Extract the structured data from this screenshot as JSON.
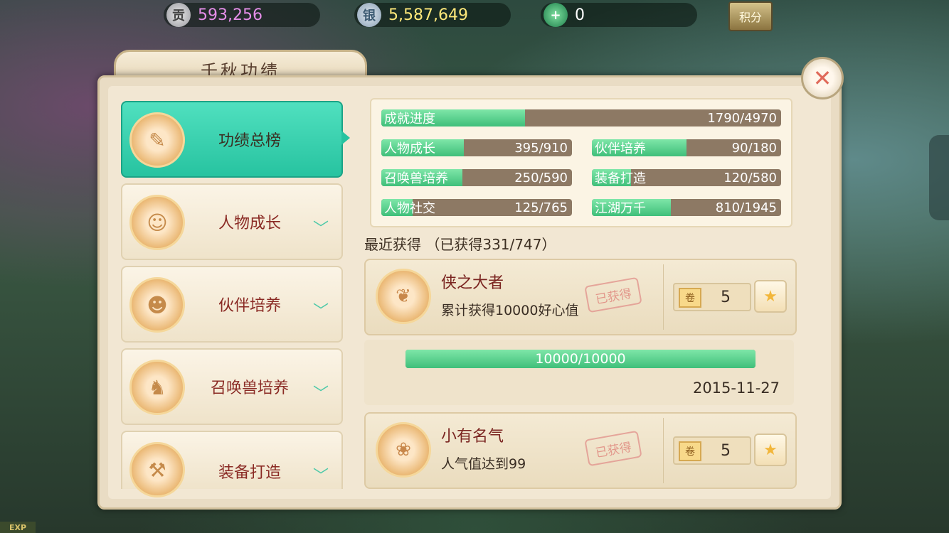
{
  "resources": {
    "gong": {
      "icon": "contribution-coin-icon",
      "glyph": "贡",
      "value": "593,256"
    },
    "silver": {
      "icon": "silver-ingot-icon",
      "glyph": "银",
      "value": "5,587,649"
    },
    "jade": {
      "icon": "jade-coin-icon",
      "glyph": "+",
      "value": "0"
    },
    "points_label": "积分"
  },
  "panel": {
    "title": "千秋功绩",
    "close_glyph": "✕"
  },
  "nav": [
    {
      "label": "功绩总榜",
      "active": true,
      "glyph": "✎"
    },
    {
      "label": "人物成长",
      "chevron": "﹀",
      "glyph": "☺"
    },
    {
      "label": "伙伴培养",
      "chevron": "﹀",
      "glyph": "☻"
    },
    {
      "label": "召唤兽培养",
      "chevron": "﹀",
      "glyph": "♞"
    },
    {
      "label": "装备打造",
      "chevron": "﹀",
      "glyph": "⚒"
    }
  ],
  "progress": {
    "overall": {
      "label": "成就进度",
      "text": "1790/4970",
      "value": 1790,
      "max": 4970
    },
    "categories": [
      {
        "label": "人物成长",
        "text": "395/910",
        "value": 395,
        "max": 910
      },
      {
        "label": "伙伴培养",
        "text": "90/180",
        "value": 90,
        "max": 180
      },
      {
        "label": "召唤兽培养",
        "text": "250/590",
        "value": 250,
        "max": 590
      },
      {
        "label": "装备打造",
        "text": "120/580",
        "value": 120,
        "max": 580
      },
      {
        "label": "人物社交",
        "text": "125/765",
        "value": 125,
        "max": 765
      },
      {
        "label": "江湖万千",
        "text": "810/1945",
        "value": 810,
        "max": 1945
      }
    ]
  },
  "recent": {
    "title": "最近获得  （已获得331/747）",
    "items": [
      {
        "name": "侠之大者",
        "desc": "累计获得10000好心值",
        "stamp": "已获得",
        "reward_icon": "scroll-icon",
        "reward_glyph": "卷",
        "reward": "5",
        "share_glyph": "★",
        "detail": {
          "text": "10000/10000",
          "value": 10000,
          "max": 10000,
          "date": "2015-11-27"
        }
      },
      {
        "name": "小有名气",
        "desc": "人气值达到99",
        "stamp": "已获得",
        "reward_icon": "scroll-icon",
        "reward_glyph": "卷",
        "reward": "5",
        "share_glyph": "★"
      }
    ]
  },
  "exp_label": "EXP"
}
